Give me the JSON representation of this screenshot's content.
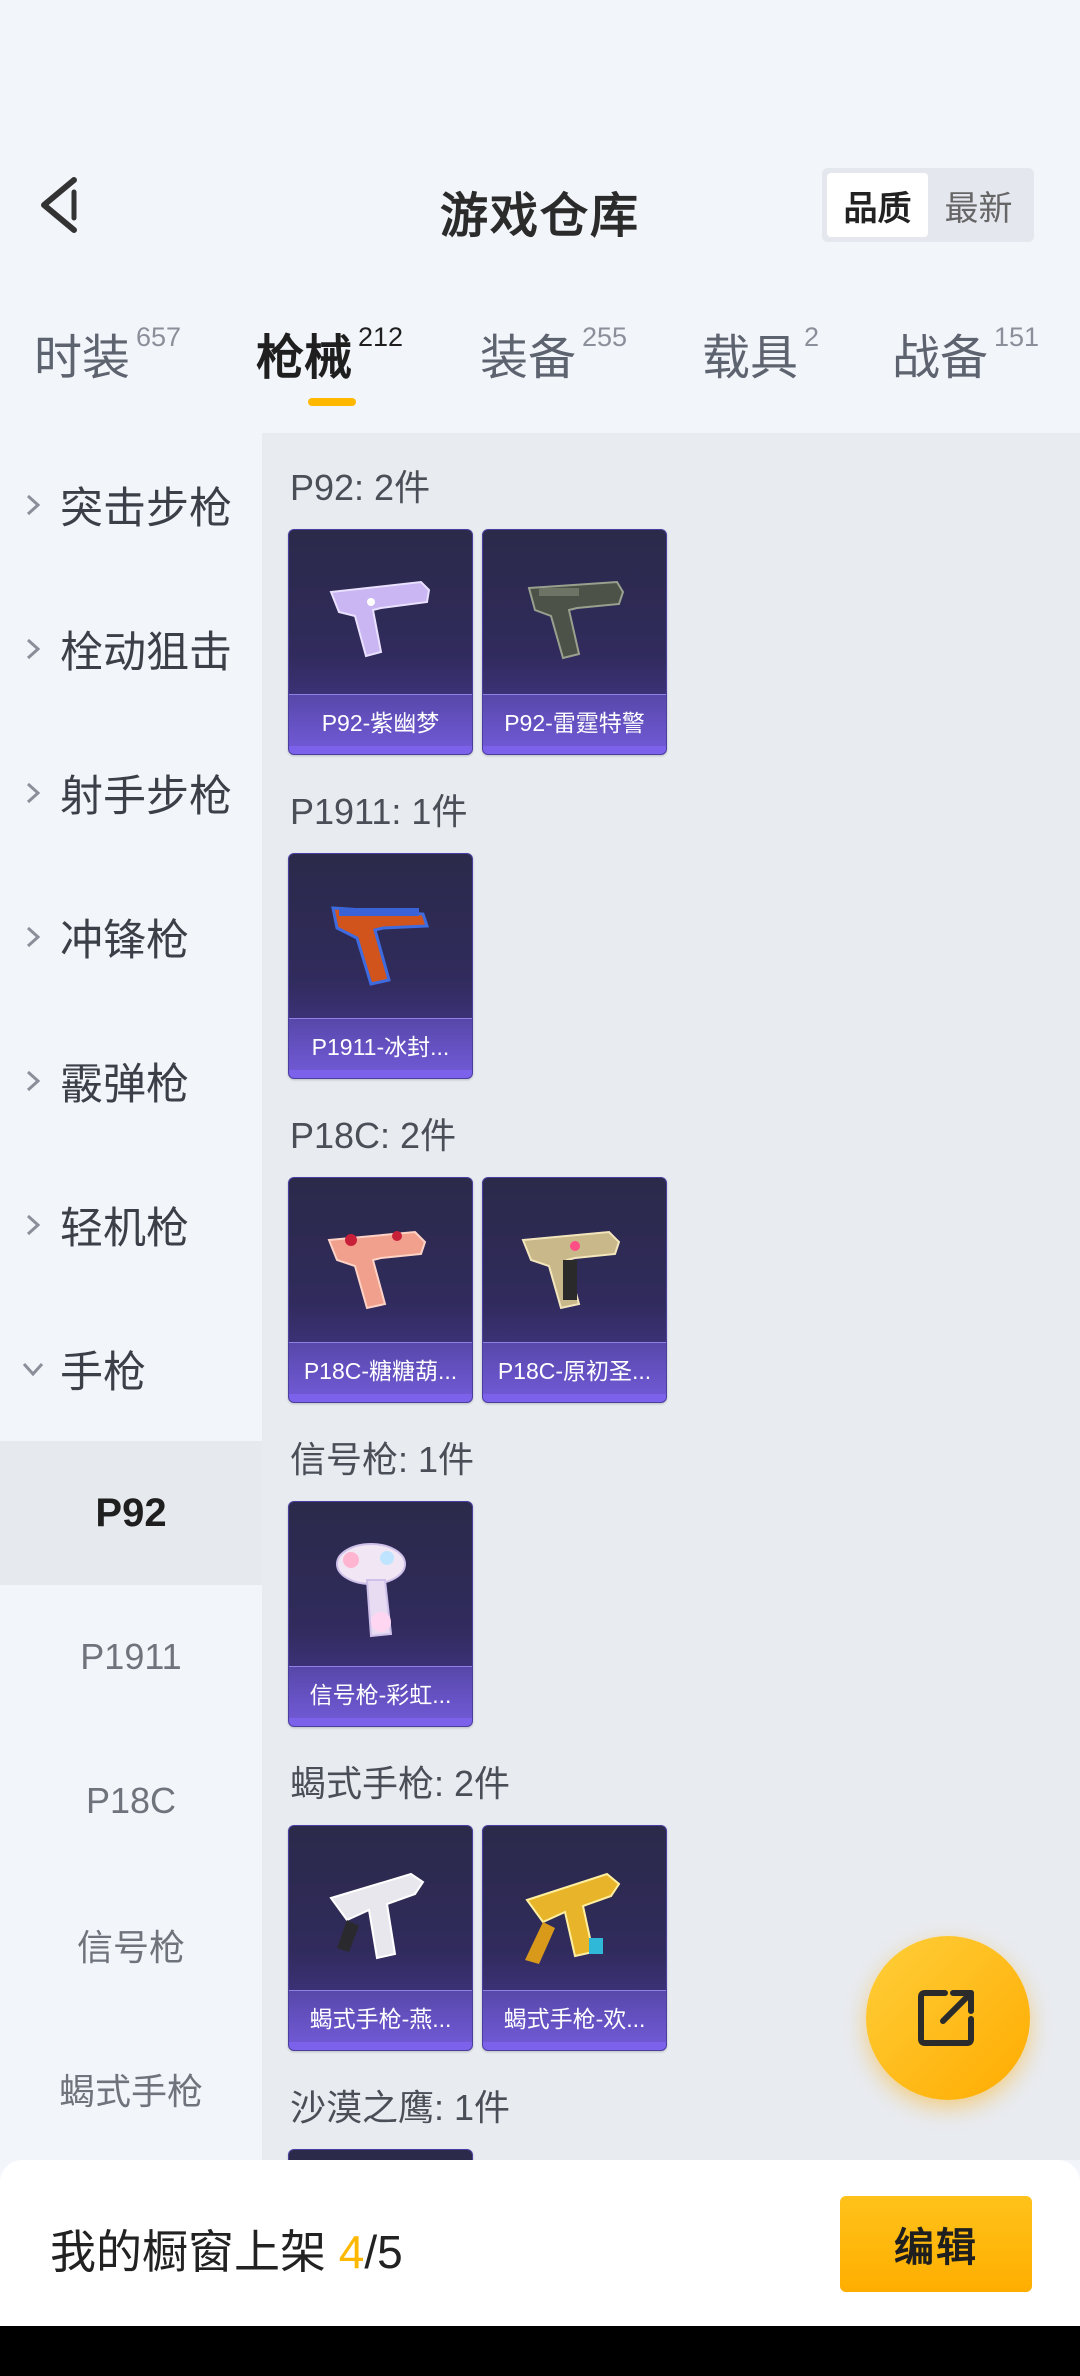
{
  "header": {
    "title": "游戏仓库",
    "sort_options": [
      "品质",
      "最新"
    ],
    "active_sort": "品质"
  },
  "tabs": [
    {
      "label": "时装",
      "count": "657"
    },
    {
      "label": "枪械",
      "count": "212"
    },
    {
      "label": "装备",
      "count": "255"
    },
    {
      "label": "载具",
      "count": "2"
    },
    {
      "label": "战备",
      "count": "151"
    }
  ],
  "active_tab": "枪械",
  "sidebar": {
    "groups": [
      "突击步枪",
      "栓动狙击",
      "射手步枪",
      "冲锋枪",
      "霰弹枪",
      "轻机枪",
      "手枪"
    ],
    "expanded_group": "手枪",
    "subitems": [
      "P92",
      "P1911",
      "P18C",
      "信号枪",
      "蝎式手枪"
    ],
    "active_subitem": "P92"
  },
  "sections": [
    {
      "title": "P92: 2件",
      "items": [
        "P92-紫幽梦",
        "P92-雷霆特警"
      ]
    },
    {
      "title": "P1911: 1件",
      "items": [
        "P1911-冰封..."
      ]
    },
    {
      "title": "P18C: 2件",
      "items": [
        "P18C-糖糖葫...",
        "P18C-原初圣..."
      ]
    },
    {
      "title": "信号枪: 1件",
      "items": [
        "信号枪-彩虹..."
      ]
    },
    {
      "title": "蝎式手枪: 2件",
      "items": [
        "蝎式手枪-燕...",
        "蝎式手枪-欢..."
      ]
    },
    {
      "title": "沙漠之鹰: 1件",
      "items": []
    }
  ],
  "bottom": {
    "showcase_label": "我的橱窗上架",
    "showcase_current": "4",
    "showcase_total": "/5",
    "edit_label": "编辑"
  },
  "colors": {
    "accent": "#ffb800",
    "card_bg": "#2e2a55",
    "card_label": "#7c62ea"
  }
}
